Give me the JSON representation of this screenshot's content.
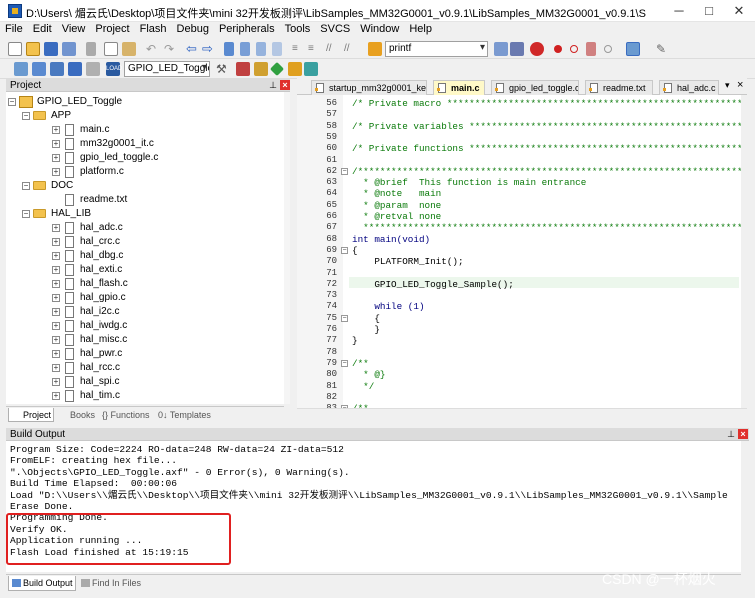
{
  "window": {
    "title": "D:\\Users\\ 煝云氏\\Desktop\\项目文件夹\\mini 32开发板测评\\LibSamples_MM32G0001_v0.9.1\\LibSamples_MM32G0001_v0.9.1\\Samples\\LibSamples\\GPIO\\GPIO_LED_Togg..."
  },
  "menu": [
    "File",
    "Edit",
    "View",
    "Project",
    "Flash",
    "Debug",
    "Peripherals",
    "Tools",
    "SVCS",
    "Window",
    "Help"
  ],
  "toolbar": {
    "find_text": "printf",
    "target_name": "GPIO_LED_Toggle"
  },
  "project_panel": {
    "title": "Project",
    "root": "GPIO_LED_Toggle",
    "groups": [
      {
        "name": "APP",
        "files": [
          "main.c",
          "mm32g0001_it.c",
          "gpio_led_toggle.c",
          "platform.c"
        ]
      },
      {
        "name": "DOC",
        "files": [
          "readme.txt"
        ]
      },
      {
        "name": "HAL_LIB",
        "files": [
          "hal_adc.c",
          "hal_crc.c",
          "hal_dbg.c",
          "hal_exti.c",
          "hal_flash.c",
          "hal_gpio.c",
          "hal_i2c.c",
          "hal_iwdg.c",
          "hal_misc.c",
          "hal_pwr.c",
          "hal_rcc.c",
          "hal_spi.c",
          "hal_tim.c"
        ]
      }
    ],
    "tabs": [
      "Project",
      "Books",
      "{} Functions",
      "0↓ Templates"
    ]
  },
  "editor_tabs": [
    "startup_mm32g0001_keil.s",
    "main.c",
    "gpio_led_toggle.c",
    "readme.txt",
    "hal_adc.c"
  ],
  "code_lines": [
    {
      "n": "56",
      "t": "/* Private macro ***********************************************************"
    },
    {
      "n": "57",
      "t": ""
    },
    {
      "n": "58",
      "t": "/* Private variables *********************************************************"
    },
    {
      "n": "59",
      "t": ""
    },
    {
      "n": "60",
      "t": "/* Private functions *********************************************************"
    },
    {
      "n": "61",
      "t": ""
    },
    {
      "n": "62",
      "t": "/***************************************************************************"
    },
    {
      "n": "63",
      "t": "  * @brief  This function is main entrance"
    },
    {
      "n": "64",
      "t": "  * @note   main"
    },
    {
      "n": "65",
      "t": "  * @param  none"
    },
    {
      "n": "66",
      "t": "  * @retval none"
    },
    {
      "n": "67",
      "t": "  *************************************************************************"
    },
    {
      "n": "68",
      "t": "int main(void)"
    },
    {
      "n": "69",
      "t": "{"
    },
    {
      "n": "70",
      "t": "    PLATFORM_Init();"
    },
    {
      "n": "71",
      "t": ""
    },
    {
      "n": "72",
      "t": "    GPIO_LED_Toggle_Sample();"
    },
    {
      "n": "73",
      "t": ""
    },
    {
      "n": "74",
      "t": "    while (1)"
    },
    {
      "n": "75",
      "t": "    {"
    },
    {
      "n": "76",
      "t": "    }"
    },
    {
      "n": "77",
      "t": "}"
    },
    {
      "n": "78",
      "t": ""
    },
    {
      "n": "79",
      "t": "/**"
    },
    {
      "n": "80",
      "t": "  * @}"
    },
    {
      "n": "81",
      "t": "  */"
    },
    {
      "n": "82",
      "t": ""
    },
    {
      "n": "83",
      "t": "/**"
    }
  ],
  "build_output": {
    "title": "Build Output",
    "lines": [
      "Program Size: Code=2224 RO-data=248 RW-data=24 ZI-data=512",
      "FromELF: creating hex file...",
      "\".\\Objects\\GPIO_LED_Toggle.axf\" - 0 Error(s), 0 Warning(s).",
      "Build Time Elapsed:  00:00:06",
      "Load \"D:\\\\Users\\\\煝云氏\\\\Desktop\\\\项目文件夹\\\\mini 32开发板测评\\\\LibSamples_MM32G0001_v0.9.1\\\\LibSamples_MM32G0001_v0.9.1\\\\Sample",
      "Erase Done.",
      "Programming Done.",
      "Verify OK.",
      "Application running ...",
      "Flash Load finished at 15:19:15"
    ],
    "tabs": [
      "Build Output",
      "Find In Files"
    ]
  },
  "watermark": "CSDN @一杯烟火",
  "colors": {
    "comment": "#0a7a0a",
    "keyword": "#00007f",
    "active_tab": "#fff9c8",
    "highlight_box": "#e02020"
  }
}
